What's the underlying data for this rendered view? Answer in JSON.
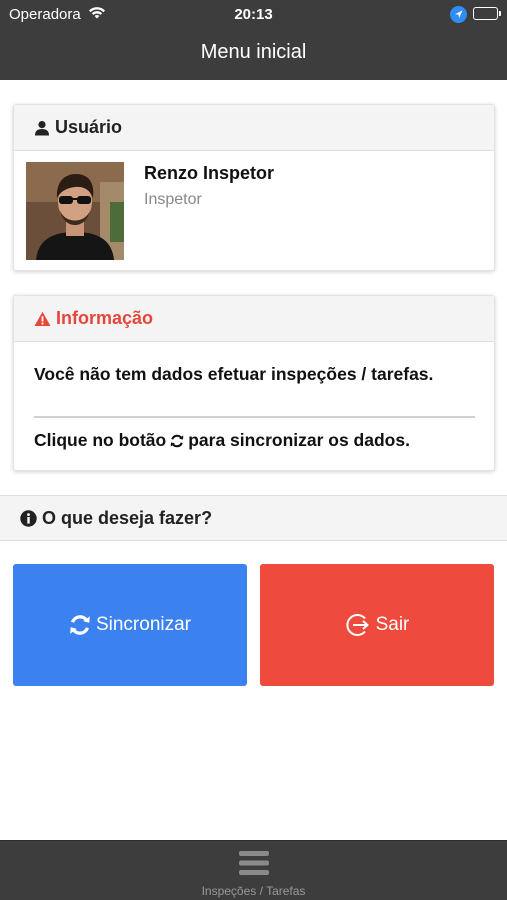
{
  "status_bar": {
    "carrier": "Operadora",
    "time": "20:13"
  },
  "navbar": {
    "title": "Menu inicial"
  },
  "user_card": {
    "header": "Usuário",
    "icon": "user-icon",
    "name": "Renzo Inspetor",
    "role": "Inspetor"
  },
  "info_card": {
    "header": "Informação",
    "icon": "warning-icon",
    "accent_color": "#e5473b",
    "message": "Você não tem dados efetuar inspeções / tarefas.",
    "sync_hint_before": "Clique no botão",
    "sync_hint_after": "para sincronizar os dados."
  },
  "question": {
    "label": "O que deseja fazer?",
    "icon": "info-circle-icon"
  },
  "actions": {
    "sync": {
      "label": "Sincronizar",
      "icon": "sync-icon",
      "color": "#3b82f0"
    },
    "exit": {
      "label": "Sair",
      "icon": "logout-icon",
      "color": "#ef4a3e"
    }
  },
  "tab_bar": {
    "items": [
      {
        "label": "Inspeções / Tarefas",
        "icon": "menu-icon"
      }
    ]
  },
  "colors": {
    "bar_background": "#3d3d3d",
    "card_header_background": "#f4f4f4"
  }
}
